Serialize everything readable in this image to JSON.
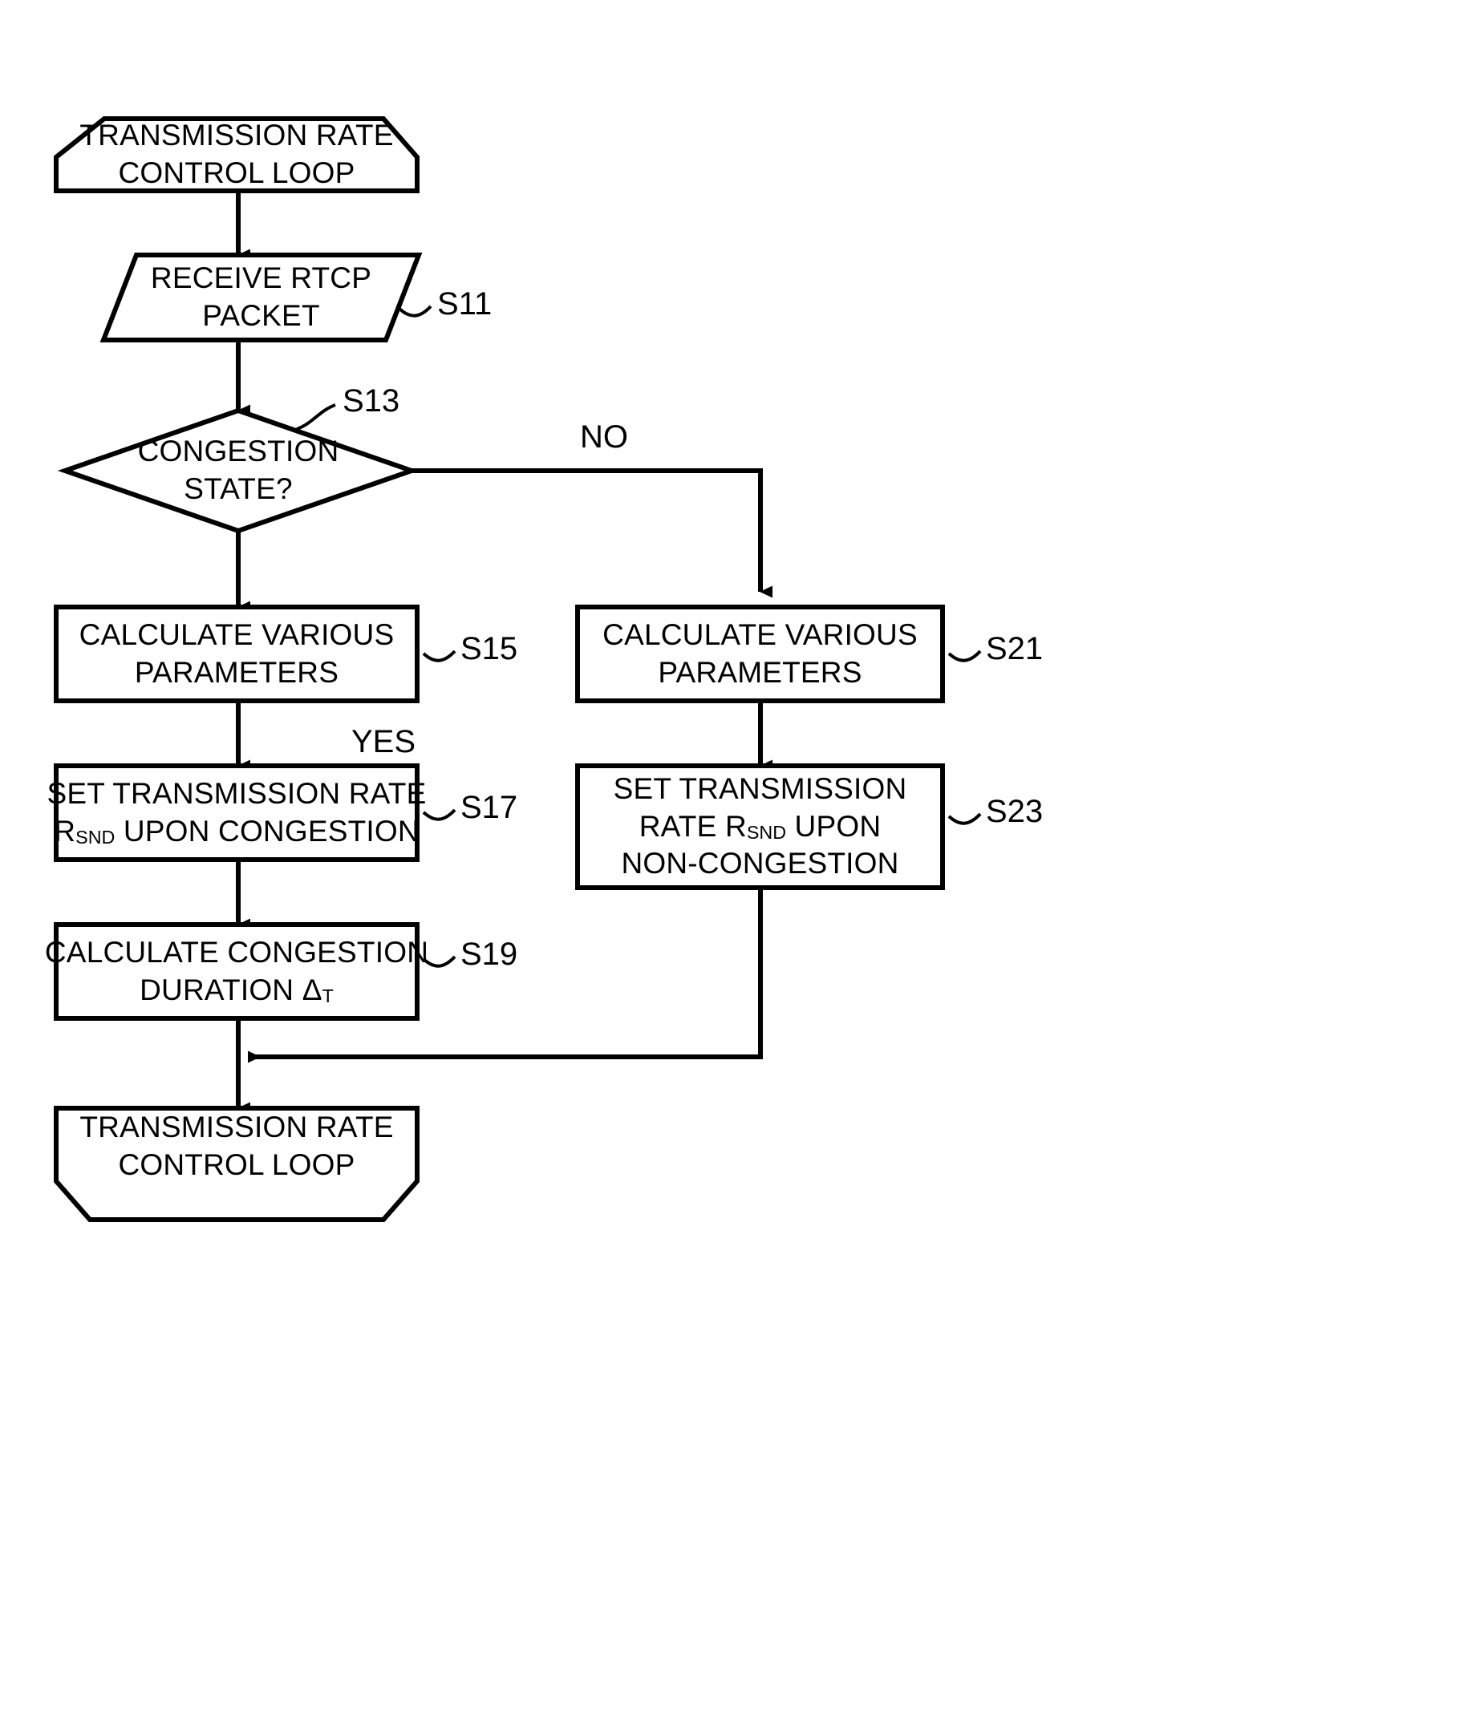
{
  "figure": {
    "type": "flowchart",
    "title": "Transmission rate control loop flowchart",
    "orientation": "vertical",
    "background_color": "#ffffff",
    "line_color": "#000000"
  },
  "nodes": {
    "start_terminal": {
      "shape": "terminator",
      "line1": "TRANSMISSION RATE",
      "line2": "CONTROL LOOP"
    },
    "receive_packet": {
      "shape": "parallelogram",
      "line1": "RECEIVE RTCP",
      "line2": "PACKET",
      "step": "S11"
    },
    "congestion_decision": {
      "shape": "diamond",
      "line1": "CONGESTION",
      "line2": "STATE?",
      "step": "S13",
      "yes_label": "YES",
      "no_label": "NO"
    },
    "calc_params_yes": {
      "shape": "process",
      "line1": "CALCULATE VARIOUS",
      "line2": "PARAMETERS",
      "step": "S15"
    },
    "set_rate_congestion": {
      "shape": "process",
      "line1": "SET TRANSMISSION RATE",
      "line2_pre": "R",
      "line2_sub": "SND",
      "line2_post": " UPON CONGESTION",
      "step": "S17"
    },
    "calc_duration": {
      "shape": "process",
      "line1": "CALCULATE CONGESTION",
      "line2_pre": "DURATION Δ",
      "line2_sub": "T",
      "line2_post": "",
      "step": "S19"
    },
    "calc_params_no": {
      "shape": "process",
      "line1": "CALCULATE VARIOUS",
      "line2": "PARAMETERS",
      "step": "S21"
    },
    "set_rate_non_congestion": {
      "shape": "process",
      "line1": "SET TRANSMISSION",
      "line2_pre": "RATE R",
      "line2_sub": "SND",
      "line2_post": " UPON",
      "line3": "NON-CONGESTION",
      "step": "S23"
    },
    "end_terminal": {
      "shape": "terminator",
      "line1": "TRANSMISSION RATE",
      "line2": "CONTROL LOOP"
    }
  }
}
